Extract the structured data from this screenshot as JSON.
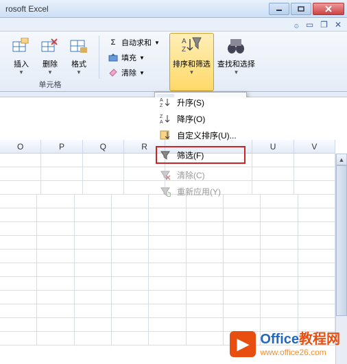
{
  "titlebar": {
    "title": "rosoft Excel"
  },
  "ribbon": {
    "cells": {
      "insert": "插入",
      "delete": "删除",
      "format": "格式",
      "group_label": "单元格"
    },
    "editing": {
      "autosum": "自动求和",
      "fill": "填充",
      "clear": "清除",
      "sort_filter": "排序和筛选",
      "find_select": "查找和选择"
    }
  },
  "dropdown": {
    "asc": "升序(S)",
    "desc": "降序(O)",
    "custom": "自定义排序(U)...",
    "filter": "筛选(F)",
    "clear": "清除(C)",
    "reapply": "重新应用(Y)"
  },
  "columns": [
    "O",
    "P",
    "Q",
    "R",
    "",
    "",
    "U",
    "V"
  ],
  "watermark": {
    "brand": "Office",
    "brand_cn": "教程网",
    "url": "www.office26.com"
  }
}
